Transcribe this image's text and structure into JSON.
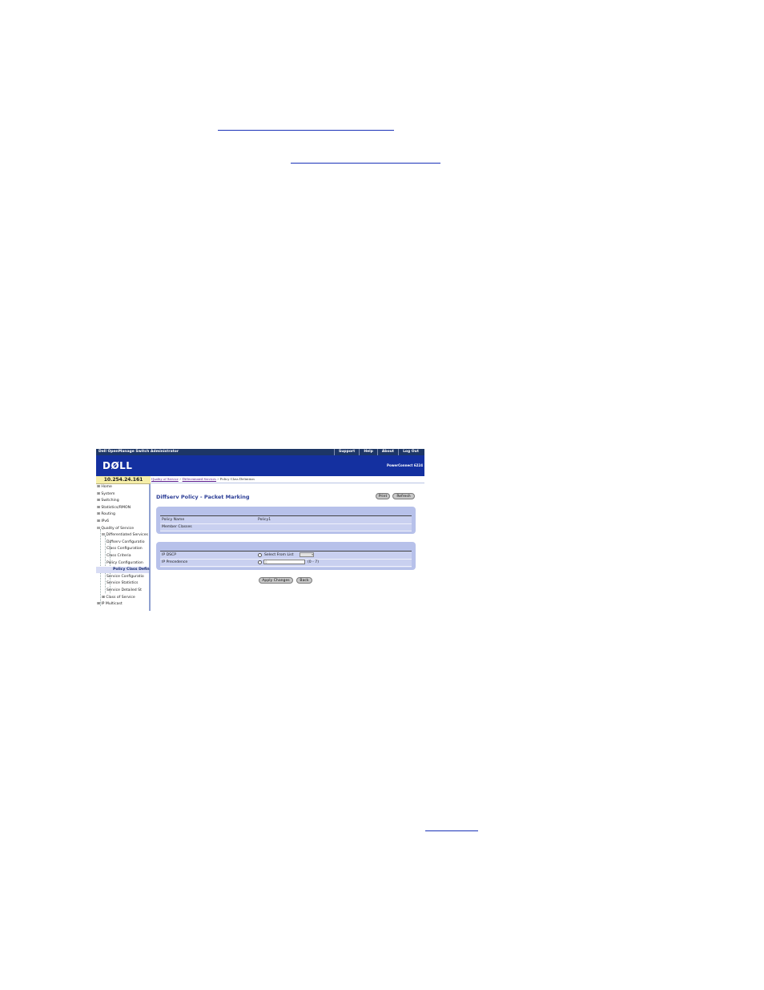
{
  "window": {
    "title": "Dell OpenManage Switch Administrator",
    "top_menu": [
      "Support",
      "Help",
      "About",
      "Log Out"
    ],
    "logo": "DØLL",
    "product": "PowerConnect 6224"
  },
  "header": {
    "ip_address": "10.254.24.161"
  },
  "breadcrumb": {
    "links": [
      "Quality of Service",
      "Differentiated Services"
    ],
    "separator": " > ",
    "current": "Policy Class Definition"
  },
  "sidebar": {
    "items": [
      {
        "label": "Home",
        "expander": "⊞"
      },
      {
        "label": "System",
        "expander": "⊞"
      },
      {
        "label": "Switching",
        "expander": "⊞"
      },
      {
        "label": "Statistics/RMON",
        "expander": "⊞"
      },
      {
        "label": "Routing",
        "expander": "⊞"
      },
      {
        "label": "IPv6",
        "expander": "⊞"
      },
      {
        "label": "Quality of Service",
        "expander": "⊟"
      },
      {
        "label": "Differentiated Services",
        "expander": "⊟"
      },
      {
        "label": "Diffserv Configuratio",
        "expander": ""
      },
      {
        "label": "Class Configuration",
        "expander": ""
      },
      {
        "label": "Class Criteria",
        "expander": ""
      },
      {
        "label": "Policy Configuration",
        "expander": ""
      },
      {
        "label": "Policy Class Defin",
        "expander": "",
        "selected": true
      },
      {
        "label": "Service Configuratio",
        "expander": ""
      },
      {
        "label": "Service Statistics",
        "expander": ""
      },
      {
        "label": "Service Detailed St",
        "expander": ""
      },
      {
        "label": "Class of Service",
        "expander": "⊞"
      },
      {
        "label": "IP Multicast",
        "expander": "⊞"
      }
    ]
  },
  "main": {
    "page_title": "Diffserv Policy - Packet Marking",
    "print_label": "Print",
    "refresh_label": "Refresh",
    "policy_name_label": "Policy Name",
    "policy_name_value": "Policy1",
    "member_classes_label": "Member Classes",
    "member_classes_value": "",
    "ip_dscp_label": "IP DSCP",
    "select_from_list_label": "Select From List",
    "ip_precedence_label": "IP Precedence",
    "ip_precedence_value": "0",
    "ip_precedence_range": "(0 - 7)",
    "apply_label": "Apply Changes",
    "back_label": "Back"
  },
  "colors": {
    "top_bar": "#1d3666",
    "banner": "#1430a0",
    "panel": "#b7c1ea",
    "ip_box": "#f6eea8",
    "title": "#2b3d96"
  }
}
